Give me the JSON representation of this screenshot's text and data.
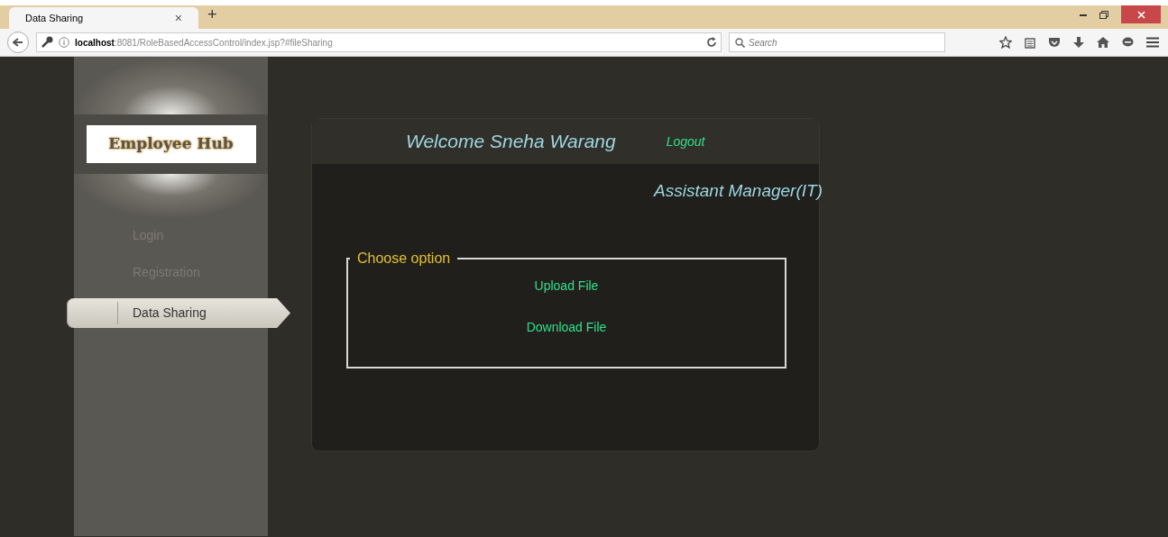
{
  "browser": {
    "tab": {
      "title": "Data Sharing",
      "close": "×"
    },
    "new_tab": "+",
    "url": {
      "host": "localhost",
      "rest": ":8081/RoleBasedAccessControl/index.jsp?#fileSharing"
    },
    "search": {
      "placeholder": "Search"
    }
  },
  "sidebar": {
    "logo": "Employee Hub",
    "items": [
      {
        "label": "Login",
        "selected": false
      },
      {
        "label": "Registration",
        "selected": false
      },
      {
        "label": "Data Sharing",
        "selected": true
      }
    ]
  },
  "panel": {
    "welcome": "Welcome Sneha Warang",
    "logout": "Logout",
    "role": "Assistant Manager(IT)",
    "fieldset": {
      "legend": "Choose option",
      "links": [
        "Upload File",
        "Download File"
      ]
    }
  }
}
